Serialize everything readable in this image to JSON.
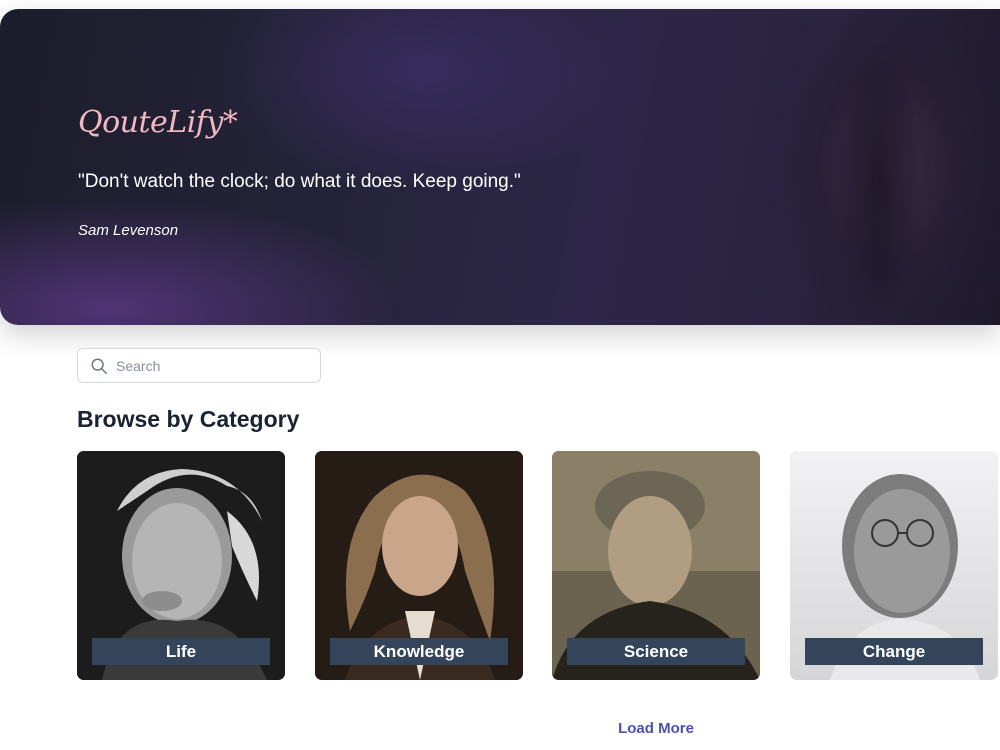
{
  "hero": {
    "logo": "QouteLify*",
    "quote": "\"Don't watch the clock; do what it does. Keep going.\"",
    "author": "Sam Levenson"
  },
  "search": {
    "placeholder": "Search",
    "value": ""
  },
  "section_title": "Browse by Category",
  "categories": [
    {
      "label": "Life",
      "image": "portrait-photo"
    },
    {
      "label": "Knowledge",
      "image": "portrait-painting"
    },
    {
      "label": "Science",
      "image": "portrait-photo"
    },
    {
      "label": "Change",
      "image": "portrait-photo"
    }
  ],
  "load_more": "Load More",
  "colors": {
    "logo": "#f2b8c2",
    "label_bg": "#34445a",
    "link": "#4b4fb8",
    "heading": "#1b2233"
  }
}
